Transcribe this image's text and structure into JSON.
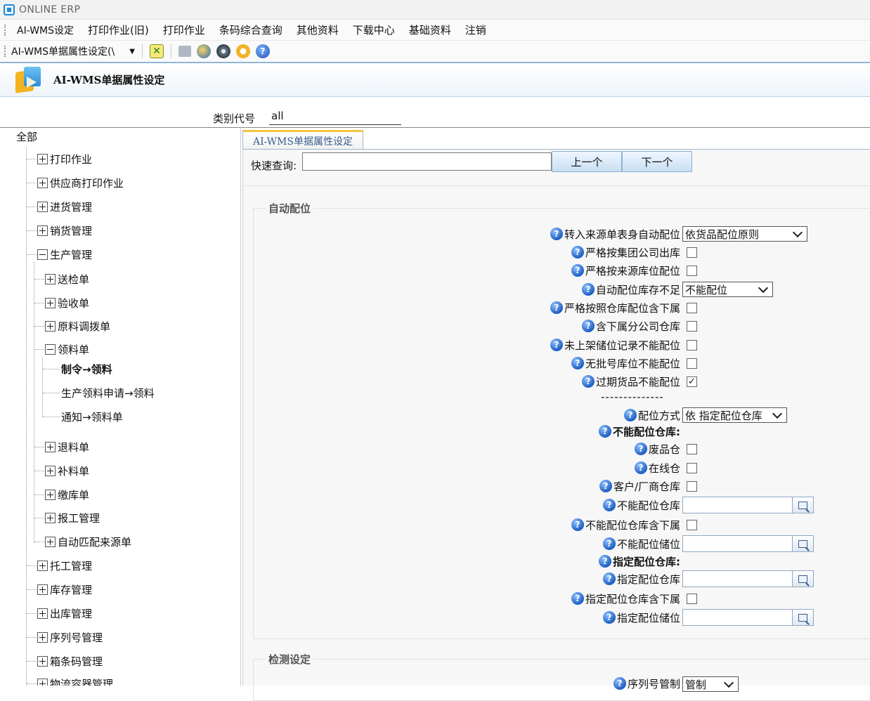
{
  "window": {
    "title": "ONLINE ERP"
  },
  "menu": [
    "AI-WMS设定",
    "打印作业(旧)",
    "打印作业",
    "条码综合查询",
    "其他资料",
    "下载中心",
    "基础资料",
    "注销"
  ],
  "toolbar": {
    "form_select": "AI-WMS单据属性设定(\\"
  },
  "header": {
    "title": "AI-WMS单据属性设定"
  },
  "category": {
    "label": "类别代号",
    "value": "all"
  },
  "tree": {
    "root": "全部",
    "nodes": [
      {
        "label": "打印作业",
        "state": "plus"
      },
      {
        "label": "供应商打印作业",
        "state": "plus"
      },
      {
        "label": "进货管理",
        "state": "plus"
      },
      {
        "label": "销货管理",
        "state": "plus"
      },
      {
        "label": "生产管理",
        "state": "minus"
      },
      {
        "label": "送检单",
        "state": "plus"
      },
      {
        "label": "验收单",
        "state": "plus"
      },
      {
        "label": "原料调拨单",
        "state": "plus"
      },
      {
        "label": "领料单",
        "state": "minus"
      },
      {
        "label": "制令→领料",
        "state": "leaf-selected"
      },
      {
        "label": "生产领料申请→领料",
        "state": "leaf"
      },
      {
        "label": "通知→领料单",
        "state": "leaf"
      },
      {
        "label": "退料单",
        "state": "plus"
      },
      {
        "label": "补料单",
        "state": "plus"
      },
      {
        "label": "缴库单",
        "state": "plus"
      },
      {
        "label": "报工管理",
        "state": "plus"
      },
      {
        "label": "自动匹配来源单",
        "state": "plus"
      },
      {
        "label": "托工管理",
        "state": "plus"
      },
      {
        "label": "库存管理",
        "state": "plus"
      },
      {
        "label": "出库管理",
        "state": "plus"
      },
      {
        "label": "序列号管理",
        "state": "plus"
      },
      {
        "label": "箱条码管理",
        "state": "plus"
      },
      {
        "label": "物流容器管理",
        "state": "plus"
      }
    ]
  },
  "panel": {
    "tab": "AI-WMS单据属性设定",
    "quick_search_label": "快速查询:",
    "prev": "上一个",
    "next": "下一个",
    "group_auto": "自动配位",
    "group_check": "检测设定",
    "separator": "--------------",
    "settings": [
      {
        "label": "转入来源单表身自动配位",
        "type": "select",
        "value": "依货品配位原则"
      },
      {
        "label": "严格按集团公司出库",
        "type": "checkbox",
        "checked": false
      },
      {
        "label": "严格按来源库位配位",
        "type": "checkbox",
        "checked": false
      },
      {
        "label": "自动配位库存不足",
        "type": "select",
        "value": "不能配位"
      },
      {
        "label": "严格按照仓库配位含下属",
        "type": "checkbox",
        "checked": false
      },
      {
        "label": "含下属分公司仓库",
        "type": "checkbox",
        "checked": false
      },
      {
        "label": "未上架储位记录不能配位",
        "type": "checkbox",
        "checked": false
      },
      {
        "label": "无批号库位不能配位",
        "type": "checkbox",
        "checked": false
      },
      {
        "label": "过期货品不能配位",
        "type": "checkbox",
        "checked": true
      },
      {
        "label": "配位方式",
        "type": "select",
        "value": "依 指定配位仓库"
      },
      {
        "label": "不能配位仓库:",
        "type": "heading"
      },
      {
        "label": "废品仓",
        "type": "checkbox",
        "checked": false
      },
      {
        "label": "在线仓",
        "type": "checkbox",
        "checked": false
      },
      {
        "label": "客户/厂商仓库",
        "type": "checkbox",
        "checked": false
      },
      {
        "label": "不能配位仓库",
        "type": "lookup",
        "value": ""
      },
      {
        "label": "不能配位仓库含下属",
        "type": "checkbox",
        "checked": false
      },
      {
        "label": "不能配位储位",
        "type": "lookup",
        "value": ""
      },
      {
        "label": "指定配位仓库:",
        "type": "heading"
      },
      {
        "label": "指定配位仓库",
        "type": "lookup",
        "value": ""
      },
      {
        "label": "指定配位仓库含下属",
        "type": "checkbox",
        "checked": false
      },
      {
        "label": "指定配位储位",
        "type": "lookup",
        "value": ""
      }
    ],
    "check_settings": [
      {
        "label": "序列号管制",
        "type": "select",
        "value": "管制"
      }
    ]
  }
}
